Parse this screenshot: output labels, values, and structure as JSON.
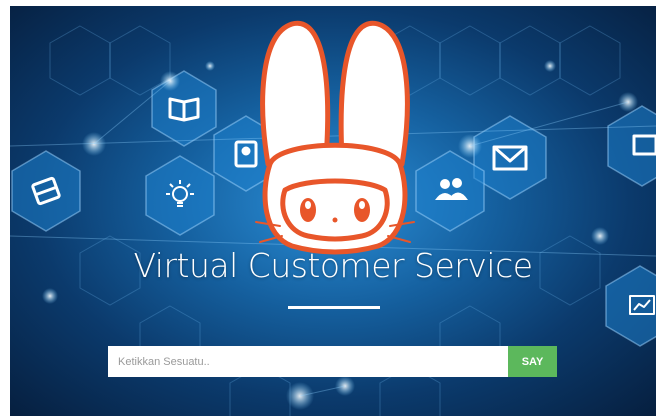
{
  "hero": {
    "title": "Virtual Customer Service"
  },
  "chat": {
    "placeholder": "Ketikkan Sesuatu..",
    "value": "",
    "send_label": "SAY"
  },
  "colors": {
    "send_button": "#5cb85c",
    "mascot_outline": "#e8562a",
    "background_accent": "#2b8fd8"
  },
  "icons": [
    "film-icon",
    "book-icon",
    "lightbulb-icon",
    "contact-card-icon",
    "mail-icon",
    "people-icon",
    "chart-icon",
    "monitor-icon",
    "rabbit-mascot"
  ]
}
